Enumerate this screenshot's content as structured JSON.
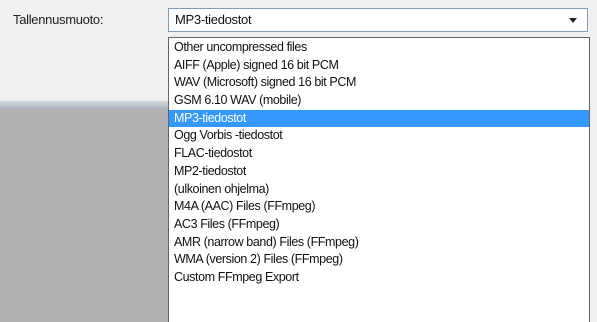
{
  "format_label": "Tallennusmuoto:",
  "combo": {
    "selected_value": "MP3-tiedostot"
  },
  "dropdown": {
    "selected_index": 4,
    "options": [
      "Other uncompressed files",
      "AIFF (Apple) signed 16 bit PCM",
      "WAV (Microsoft) signed 16 bit PCM",
      "GSM 6.10 WAV (mobile)",
      "MP3-tiedostot",
      "Ogg Vorbis -tiedostot",
      "FLAC-tiedostot",
      "MP2-tiedostot",
      "(ulkoinen ohjelma)",
      "M4A (AAC) Files (FFmpeg)",
      "AC3 Files (FFmpeg)",
      "AMR (narrow band) Files (FFmpeg)",
      "WMA (version 2) Files (FFmpeg)",
      "Custom FFmpeg Export"
    ]
  },
  "colors": {
    "selection": "#3399ff",
    "dialog_background": "#f0f0f0",
    "combo_border": "#7f9db9"
  }
}
